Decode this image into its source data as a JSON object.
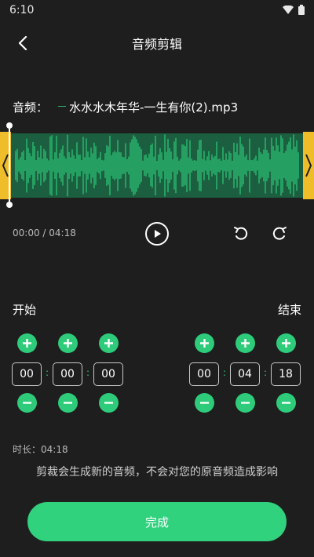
{
  "status_bar": {
    "time": "6:10",
    "icons": [
      "wifi-icon",
      "battery-icon"
    ]
  },
  "header": {
    "title": "音频剪辑",
    "back_icon": "chevron-left-icon"
  },
  "audio": {
    "label": "音频：",
    "file_name": "水水水木年华-一生有你(2).mp3"
  },
  "waveform": {
    "handle_left_icon": "chevron-left-icon",
    "handle_right_icon": "chevron-right-icon",
    "colors": {
      "wave": "#2ecc7a",
      "selection": "#1c5f40",
      "handle": "#f0bd2a"
    }
  },
  "player": {
    "time": "00:00 / 04:18",
    "play_icon": "play-icon",
    "undo_icon": "undo-icon",
    "redo_icon": "redo-icon"
  },
  "start": {
    "label": "开始",
    "hours": "00",
    "minutes": "00",
    "seconds": "00"
  },
  "end": {
    "label": "结束",
    "hours": "00",
    "minutes": "04",
    "seconds": "18"
  },
  "duration": "时长：04:18",
  "hint": "剪裁会生成新的音频，不会对您的原音频造成影响",
  "done_button": "完成",
  "accent_color": "#30d27e"
}
